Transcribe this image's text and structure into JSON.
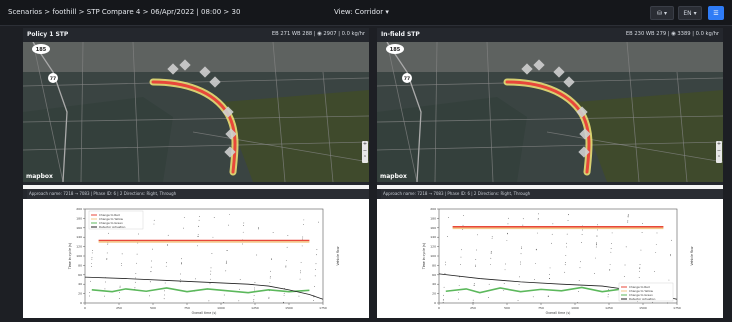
{
  "breadcrumb": "Scenarios > foothill > STP Compare 4 > 06/Apr/2022 | 08:00 > 30",
  "view_label": "View: Corridor ▾",
  "toolbar": {
    "layers_label": "⛁ ▾",
    "lang_label": "EN ▾",
    "menu_label": "☰"
  },
  "colors": {
    "accent": "#2f7cf6",
    "route_red": "#e8473a",
    "route_yellow": "#f3e879",
    "red_line": "#e8473a",
    "yellow_line": "#f3c98a",
    "green_line": "#5cb85c",
    "detector": "#111111"
  },
  "panels": [
    {
      "title": "Policy 1 STP",
      "stats": "EB 271 WB 288 | ◉ 2907 | 0.0 kg/hr",
      "map": {
        "route_badge": "185",
        "road_badge": "77",
        "attribution": "mapbox"
      },
      "approach": "Approach name: 7218 → 7083 | Phase ID: 6 | 2 Directions: Right, Through",
      "chart_data": {
        "type": "line",
        "xlabel": "Overall time (s)",
        "ylabel": "Time in cycle (s)",
        "y2label": "Vehicle flow",
        "x_ticks": [
          "0",
          "250",
          "500",
          "750",
          "1000",
          "1250",
          "1500",
          "1750"
        ],
        "y_ticks": [
          "0",
          "20",
          "40",
          "60",
          "80",
          "100",
          "120",
          "140",
          "160",
          "180",
          "200"
        ],
        "legend": [
          "Change to Red",
          "Change to Yellow",
          "Change to Green",
          "Detector Actuation"
        ],
        "legend_position": "top-left",
        "series": [
          {
            "name": "Change to Red",
            "color": "#e8473a",
            "x": [
              100,
              1650
            ],
            "y": [
              133,
              133
            ]
          },
          {
            "name": "Change to Yellow",
            "color": "#f3c98a",
            "x": [
              100,
              1650
            ],
            "y": [
              130,
              130
            ]
          },
          {
            "name": "Change to Green",
            "color": "#5cb85c",
            "x": [
              50,
              200,
              300,
              450,
              600,
              750,
              900,
              1050,
              1200,
              1350,
              1500,
              1650
            ],
            "y": [
              28,
              24,
              30,
              25,
              32,
              24,
              30,
              26,
              22,
              28,
              24,
              27
            ]
          },
          {
            "name": "Vehicle flow",
            "color": "#222222",
            "x": [
              0,
              300,
              600,
              900,
              1200,
              1350,
              1500,
              1650,
              1750
            ],
            "y": [
              55,
              52,
              48,
              44,
              40,
              36,
              28,
              18,
              8
            ]
          }
        ]
      }
    },
    {
      "title": "In-field STP",
      "stats": "EB 230 WB 279 | ◉ 3389 | 0.0 kg/hr",
      "map": {
        "route_badge": "185",
        "road_badge": "77",
        "attribution": "mapbox"
      },
      "approach": "Approach name: 7218 → 7083 | Phase ID: 6 | 2 Directions: Right, Through",
      "chart_data": {
        "type": "line",
        "xlabel": "Overall time (s)",
        "ylabel": "Time in cycle (s)",
        "y2label": "Vehicle flow",
        "x_ticks": [
          "0",
          "250",
          "500",
          "750",
          "1000",
          "1250",
          "1500",
          "1750"
        ],
        "y_ticks": [
          "0",
          "20",
          "40",
          "60",
          "80",
          "100",
          "120",
          "140",
          "160",
          "180",
          "200"
        ],
        "legend": [
          "Change to Red",
          "Change to Yellow",
          "Change to Green",
          "Detector Actuation"
        ],
        "legend_position": "bottom-right",
        "series": [
          {
            "name": "Change to Red",
            "color": "#e8473a",
            "x": [
              100,
              1650
            ],
            "y": [
              162,
              162
            ]
          },
          {
            "name": "Change to Yellow",
            "color": "#f3c98a",
            "x": [
              100,
              1650
            ],
            "y": [
              159,
              159
            ]
          },
          {
            "name": "Change to Green",
            "color": "#5cb85c",
            "x": [
              50,
              200,
              300,
              450,
              600,
              750,
              900,
              1050,
              1200,
              1350,
              1500,
              1650
            ],
            "y": [
              25,
              30,
              22,
              32,
              24,
              29,
              26,
              33,
              24,
              30,
              25,
              28
            ]
          },
          {
            "name": "Vehicle flow",
            "color": "#222222",
            "x": [
              0,
              300,
              600,
              900,
              1200,
              1350,
              1500,
              1650,
              1750
            ],
            "y": [
              62,
              52,
              45,
              40,
              36,
              30,
              22,
              14,
              8
            ]
          }
        ]
      }
    }
  ]
}
